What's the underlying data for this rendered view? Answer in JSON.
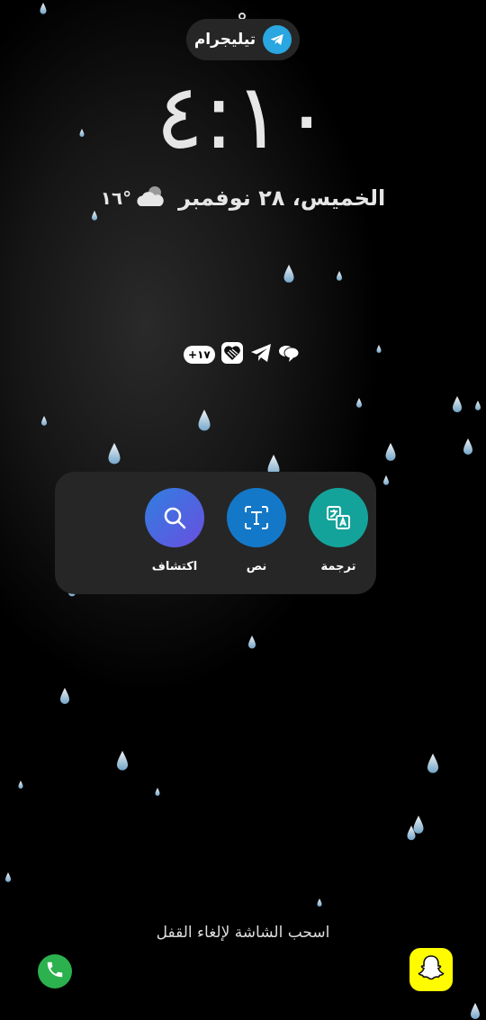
{
  "notification": {
    "app_label": "تيليجرام",
    "app_icon": "telegram-icon"
  },
  "clock": {
    "time": "٤:١٠"
  },
  "date": {
    "text": "الخميس، ٢٨ نوفمبر",
    "temperature": "١٦°",
    "weather_icon": "cloudy-night-icon"
  },
  "status_icons": {
    "count_badge": "+١٧",
    "icons": [
      "heart-app-icon",
      "telegram-icon",
      "chat-bubbles-icon"
    ]
  },
  "quick_actions": [
    {
      "label": "ترجمة",
      "icon": "translate-icon",
      "color": "#14a39a"
    },
    {
      "label": "نص",
      "icon": "text-scan-icon",
      "color": "#1478c8"
    },
    {
      "label": "اكتشاف",
      "icon": "search-icon",
      "color": "#4d5be0"
    }
  ],
  "unlock_hint": "اسحب الشاشة لإلغاء القفل",
  "shortcuts": {
    "left": "phone-icon",
    "right": "snapchat-icon"
  },
  "colors": {
    "phone_green": "#2bb14d",
    "snapchat_yellow": "#fffc00",
    "telegram_blue": "#2aa6e0"
  }
}
